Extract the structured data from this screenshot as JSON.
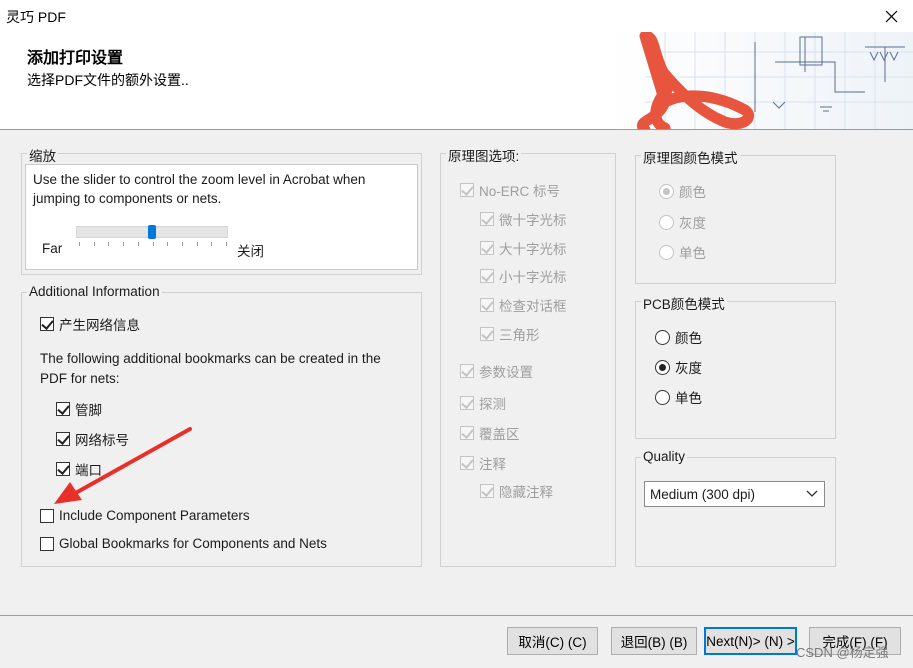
{
  "window": {
    "title": "灵巧 PDF"
  },
  "header": {
    "title": "添加打印设置",
    "subtitle": "选择PDF文件的额外设置.."
  },
  "zoom": {
    "group_label": "缩放",
    "description": "Use the slider to control the zoom level in Acrobat when jumping to components or nets.",
    "left_label": "Far",
    "right_label": "关闭",
    "slider_value": 0.5
  },
  "additional": {
    "group_label": "Additional Information",
    "net_info_label": "产生网络信息",
    "bookmarks_text": "The following additional bookmarks can be created in the PDF for nets:",
    "pins_label": "管脚",
    "netlabels_label": "网络标号",
    "ports_label": "端口",
    "component_params_label": "Include Component Parameters",
    "global_bookmarks_label": "Global Bookmarks for Components and Nets"
  },
  "schematic_options": {
    "group_label": "原理图选项:",
    "no_erc_label": "No-ERC 标号",
    "small_cross_label": "微十字光标",
    "large_cross_label": "大十字光标",
    "tiny_cross_label": "小十字光标",
    "check_dialog_label": "检查对话框",
    "triangle_label": "三角形",
    "params_label": "参数设置",
    "probe_label": "探测",
    "cover_label": "覆盖区",
    "notes_label": "注释",
    "hidden_notes_label": "隐藏注释"
  },
  "schematic_color": {
    "group_label": "原理图颜色模式",
    "color_label": "颜色",
    "gray_label": "灰度",
    "mono_label": "单色",
    "selected": "颜色"
  },
  "pcb_color": {
    "group_label": "PCB颜色模式",
    "color_label": "颜色",
    "gray_label": "灰度",
    "mono_label": "单色",
    "selected": "灰度"
  },
  "quality": {
    "group_label": "Quality",
    "selected": "Medium (300 dpi)"
  },
  "footer": {
    "cancel_label": "取消(C) (C)",
    "back_label": "退回(B) (B)",
    "next_label": "Next(N)> (N) >",
    "finish_label": "完成(F) (F)",
    "watermark": "CSDN @杨定强"
  },
  "colors": {
    "accent": "#0078d7",
    "annotation_arrow": "#e8302a",
    "logo": "#e8553e"
  }
}
